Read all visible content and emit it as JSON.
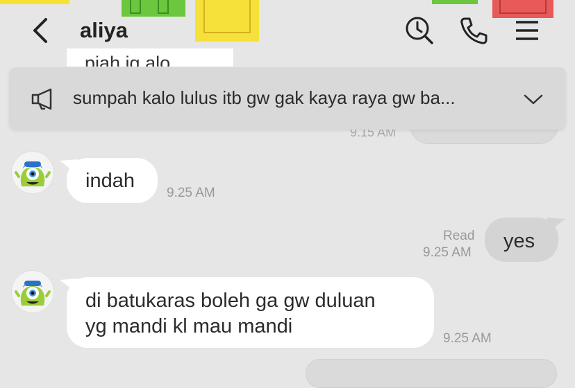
{
  "header": {
    "title": "aliya",
    "icons": [
      "back-chevron-icon",
      "search-clock-icon",
      "phone-icon",
      "menu-icon"
    ]
  },
  "previous_fragment": "piah jg alo",
  "announcement": {
    "text": "sumpah kalo lulus itb gw gak kaya raya gw ba...",
    "icon": "megaphone-icon"
  },
  "older_message": {
    "time": "9.15 AM"
  },
  "messages": [
    {
      "direction": "incoming",
      "text": "indah",
      "time": "9.25 AM"
    },
    {
      "direction": "outgoing",
      "text": "yes",
      "status": "Read",
      "time": "9.25 AM"
    },
    {
      "direction": "incoming",
      "line1": "di batukaras boleh ga gw duluan",
      "line2": "yg mandi kl mau mandi",
      "time": "9.25 AM"
    }
  ],
  "colors": {
    "background": "#e6e6e6",
    "incoming_bubble": "#ffffff",
    "outgoing_bubble": "#d4d4d4",
    "banner": "#d9d9d9"
  }
}
